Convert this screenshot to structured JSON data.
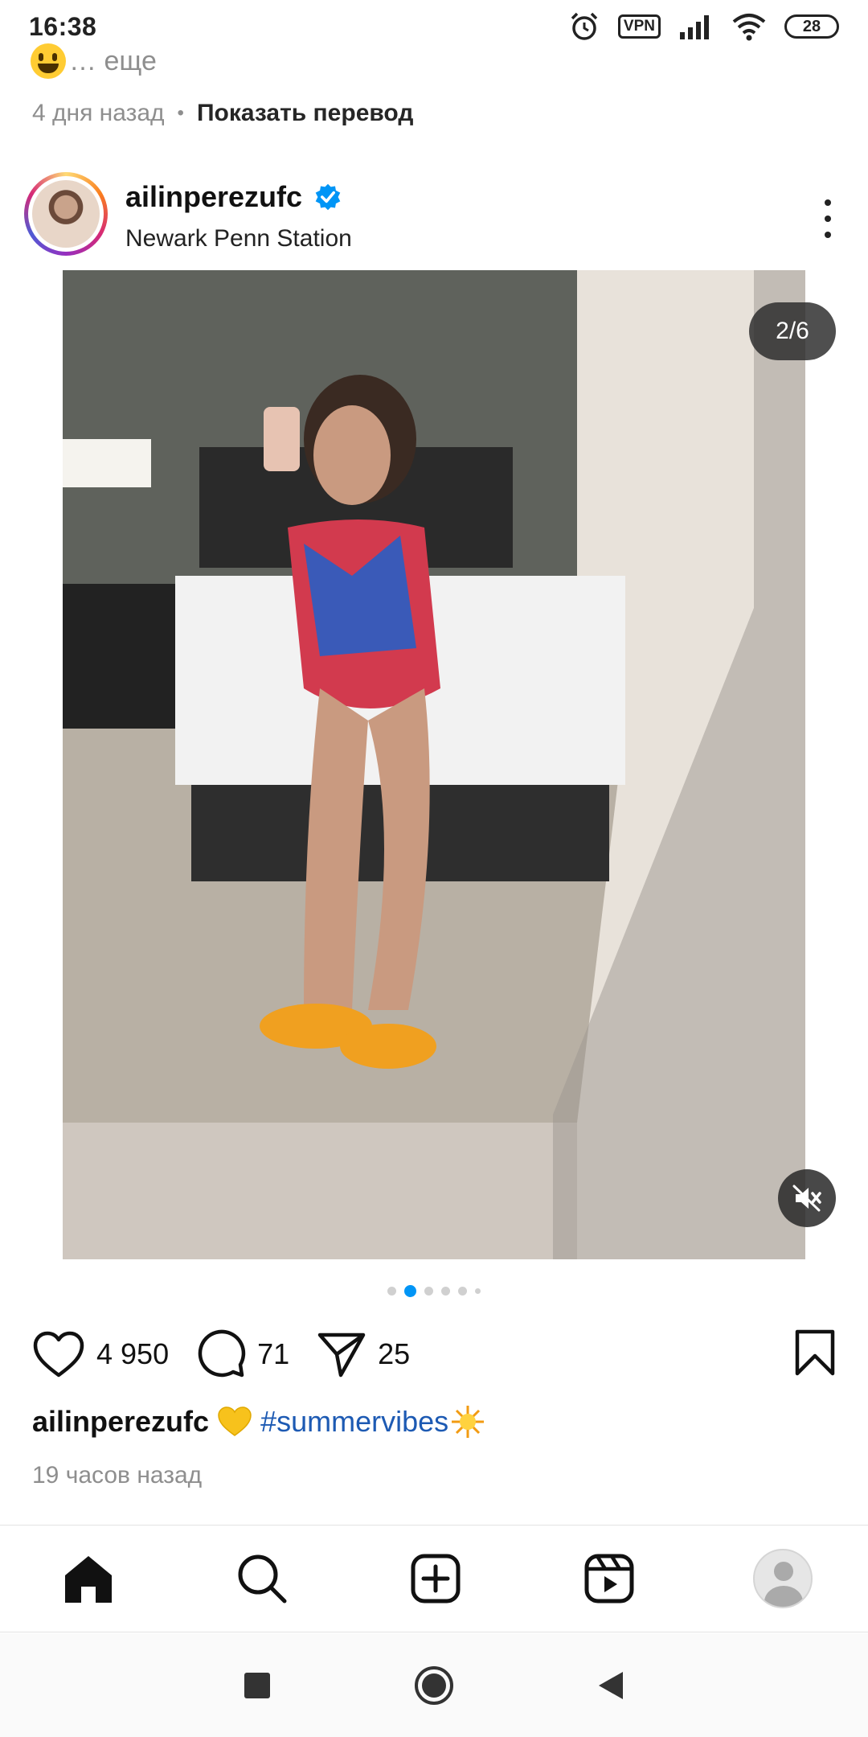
{
  "status_bar": {
    "time": "16:38",
    "vpn": "VPN",
    "battery": "28"
  },
  "previous_post": {
    "more_label": "… еще",
    "time": "4 дня назад",
    "separator": "•",
    "translate_label": "Показать перевод"
  },
  "post": {
    "username": "ailinperezufc",
    "location": "Newark Penn Station",
    "carousel_counter": "2/6",
    "likes": "4 950",
    "comments": "71",
    "shares": "25",
    "caption_user": "ailinperezufc",
    "caption_hashtag": "#summervibes",
    "time": "19 часов назад"
  },
  "colors": {
    "accent": "#0095f6",
    "hashtag": "#1d5ab3",
    "verified": "#0095f6",
    "muted": "#8e8e8e"
  },
  "icons": [
    "alarm-icon",
    "wifi-icon",
    "signal-icon",
    "heart-icon",
    "comment-icon",
    "share-icon",
    "bookmark-icon",
    "home-icon",
    "search-icon",
    "create-icon",
    "reels-icon",
    "mute-icon"
  ]
}
